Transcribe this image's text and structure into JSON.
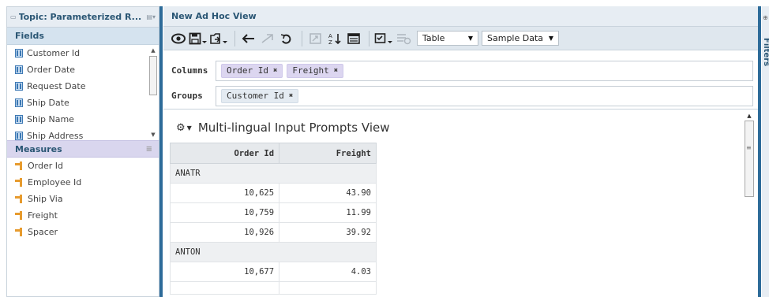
{
  "topic": {
    "title": "Topic: Parameterized R..."
  },
  "fields": {
    "header": "Fields",
    "items": [
      {
        "label": "Customer Id"
      },
      {
        "label": "Order Date"
      },
      {
        "label": "Request Date"
      },
      {
        "label": "Ship Date"
      },
      {
        "label": "Ship Name"
      },
      {
        "label": "Ship Address"
      }
    ]
  },
  "measures": {
    "header": "Measures",
    "items": [
      {
        "label": "Order Id"
      },
      {
        "label": "Employee Id"
      },
      {
        "label": "Ship Via"
      },
      {
        "label": "Freight"
      },
      {
        "label": "Spacer"
      }
    ]
  },
  "view": {
    "title": "New Ad Hoc View"
  },
  "toolbar": {
    "view_type_select": "Table",
    "data_select": "Sample Data"
  },
  "columns_row": {
    "label": "Columns",
    "pills": [
      {
        "label": "Order Id"
      },
      {
        "label": "Freight"
      }
    ]
  },
  "groups_row": {
    "label": "Groups",
    "pills": [
      {
        "label": "Customer Id"
      }
    ]
  },
  "report": {
    "title": "Multi-lingual Input Prompts View",
    "headers": {
      "order_id": "Order Id",
      "freight": "Freight"
    },
    "groups": [
      {
        "name": "ANATR",
        "rows": [
          {
            "order_id": "10,625",
            "freight": "43.90"
          },
          {
            "order_id": "10,759",
            "freight": "11.99"
          },
          {
            "order_id": "10,926",
            "freight": "39.92"
          }
        ]
      },
      {
        "name": "ANTON",
        "rows": [
          {
            "order_id": "10,677",
            "freight": "4.03"
          }
        ]
      }
    ]
  },
  "filters_panel": {
    "label": "Filters"
  },
  "colors": {
    "accent": "#2d6b99",
    "header_bg": "#e7edf3",
    "fields_header_bg": "#d5e3ef",
    "measures_header_bg": "#d9d6ee",
    "column_pill_bg": "#dcd6f0",
    "group_pill_bg": "#e4ebf2",
    "measure_icon": "#e79b2e",
    "field_icon": "#3d79b4"
  }
}
